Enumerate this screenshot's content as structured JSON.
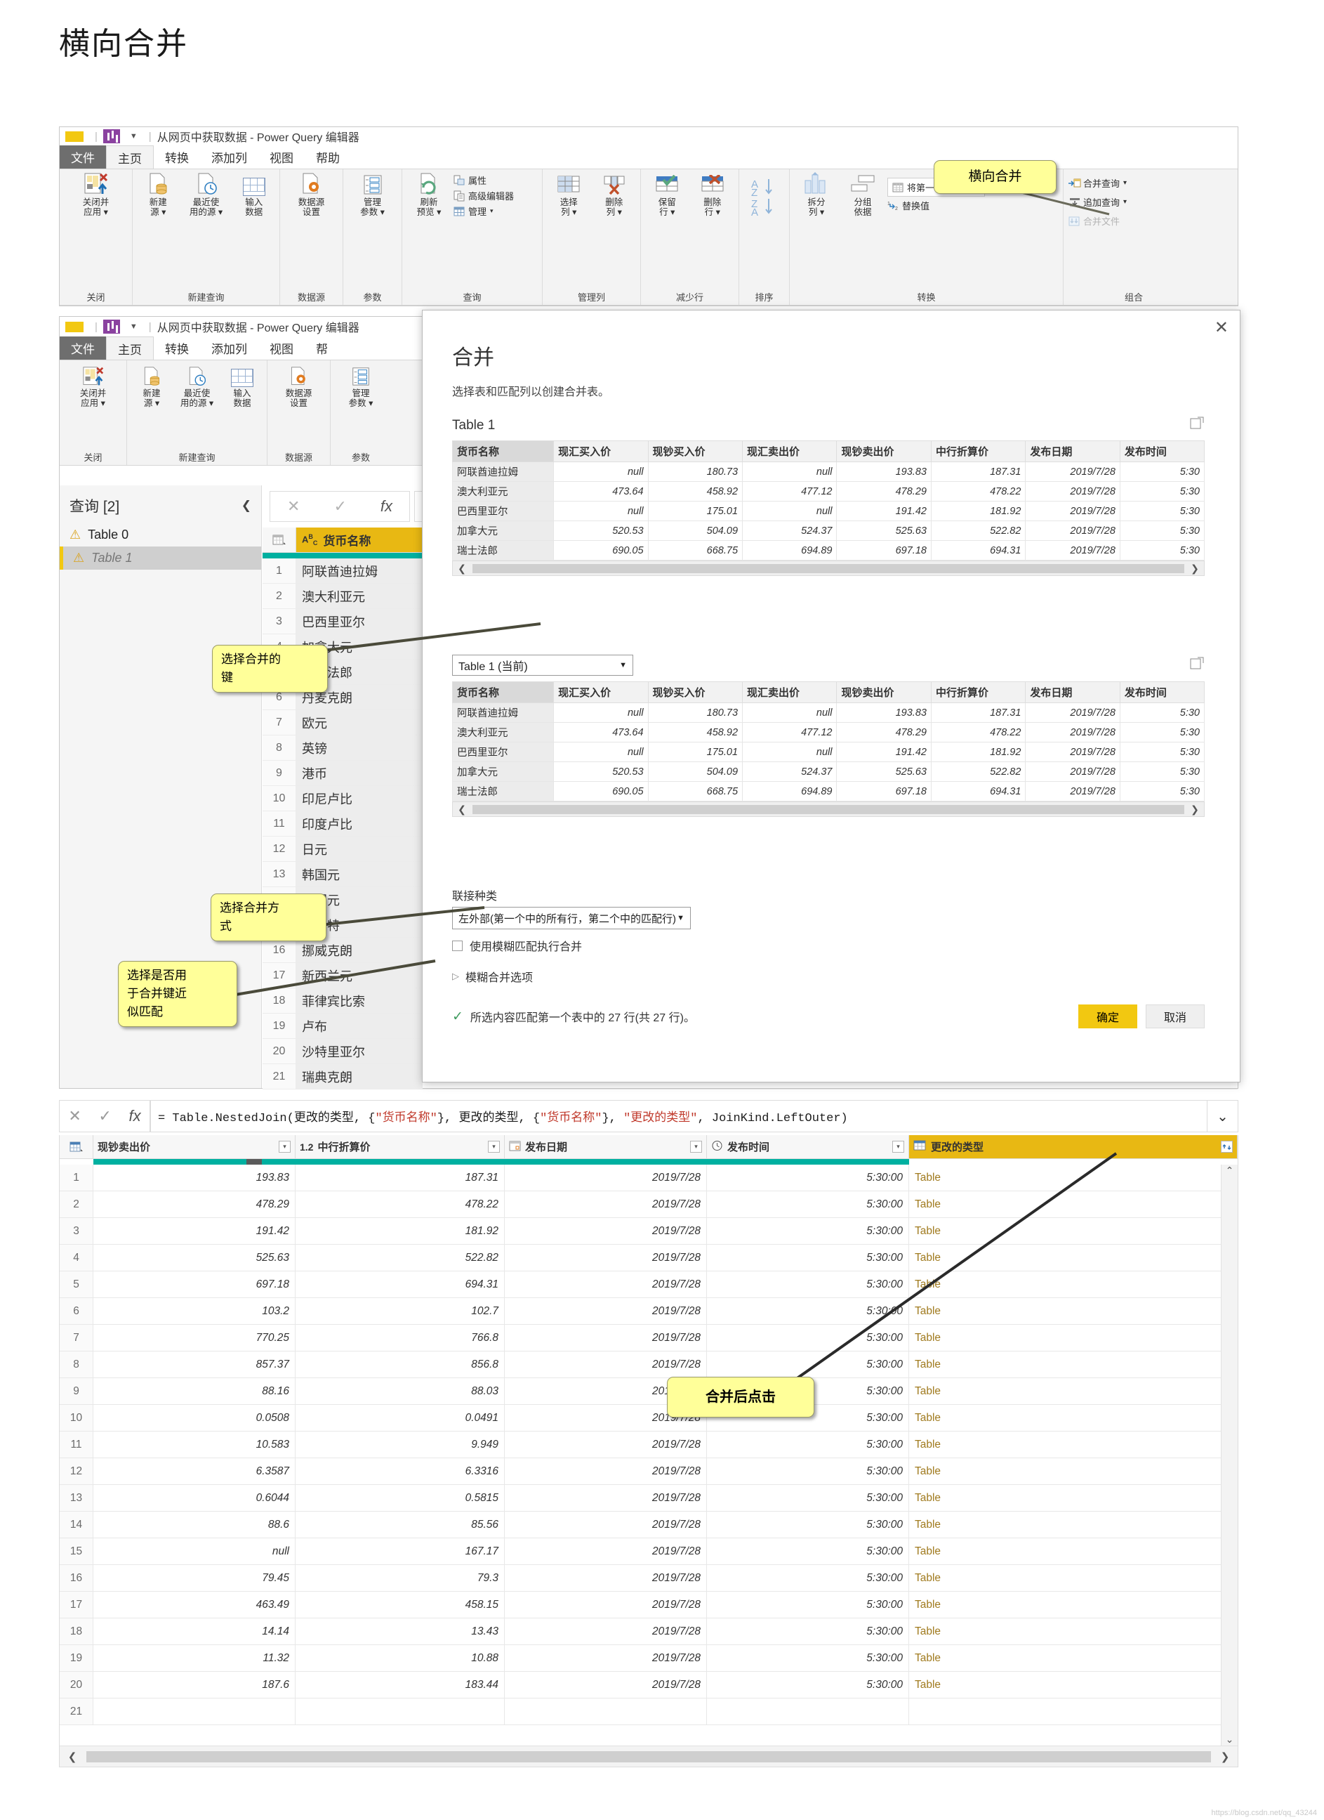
{
  "page": {
    "title": "横向合并",
    "watermark": "https://blog.csdn.net/qq_43244"
  },
  "ribbon_window": {
    "titlebar": {
      "doc_title": "从网页中获取数据 - Power Query 编辑器",
      "caret": "▼"
    },
    "tabs": [
      {
        "label": "文件",
        "kind": "file"
      },
      {
        "label": "主页",
        "kind": "active"
      },
      {
        "label": "转换",
        "kind": "normal"
      },
      {
        "label": "添加列",
        "kind": "normal"
      },
      {
        "label": "视图",
        "kind": "normal"
      },
      {
        "label": "帮助",
        "kind": "normal"
      }
    ],
    "groups": [
      {
        "label": "关闭",
        "buttons": [
          {
            "label": "关闭并\n应用",
            "caret": true,
            "icon": "close-apply-icon"
          }
        ]
      },
      {
        "label": "新建查询",
        "buttons": [
          {
            "label": "新建\n源",
            "caret": true,
            "icon": "new-source-icon"
          },
          {
            "label": "最近使\n用的源",
            "caret": true,
            "icon": "recent-source-icon"
          },
          {
            "label": "输入\n数据",
            "caret": false,
            "icon": "enter-data-icon"
          }
        ]
      },
      {
        "label": "数据源",
        "buttons": [
          {
            "label": "数据源\n设置",
            "caret": false,
            "icon": "data-source-settings-icon"
          }
        ]
      },
      {
        "label": "参数",
        "buttons": [
          {
            "label": "管理\n参数",
            "caret": true,
            "icon": "manage-parameters-icon"
          }
        ]
      },
      {
        "label": "查询",
        "buttons": [
          {
            "label": "刷新\n预览",
            "caret": true,
            "icon": "refresh-preview-icon"
          }
        ],
        "small": [
          {
            "label": "属性",
            "icon": "properties-icon"
          },
          {
            "label": "高级编辑器",
            "icon": "advanced-editor-icon"
          },
          {
            "label": "管理",
            "icon": "manage-icon",
            "caret": true
          }
        ]
      },
      {
        "label": "管理列",
        "buttons": [
          {
            "label": "选择\n列",
            "caret": true,
            "icon": "choose-columns-icon"
          },
          {
            "label": "删除\n列",
            "caret": true,
            "icon": "remove-columns-icon"
          }
        ]
      },
      {
        "label": "减少行",
        "buttons": [
          {
            "label": "保留\n行",
            "caret": true,
            "icon": "keep-rows-icon"
          },
          {
            "label": "删除\n行",
            "caret": true,
            "icon": "remove-rows-icon"
          }
        ]
      },
      {
        "label": "排序",
        "buttons": [
          {
            "label": "",
            "caret": false,
            "icon": "sort-asc-icon"
          }
        ]
      },
      {
        "label": "转换",
        "buttons": [
          {
            "label": "拆分\n列",
            "caret": true,
            "icon": "split-column-icon"
          },
          {
            "label": "分组\n依据",
            "caret": false,
            "icon": "group-by-icon"
          }
        ],
        "small": [
          {
            "label": "将第一行用作标题",
            "icon": "use-first-row-as-headers-icon",
            "caret": true
          },
          {
            "label": "替换值",
            "icon": "replace-values-icon"
          }
        ]
      },
      {
        "label": "组合",
        "small": [
          {
            "label": "合并查询",
            "icon": "merge-queries-icon",
            "caret": true
          },
          {
            "label": "追加查询",
            "icon": "append-queries-icon",
            "caret": true
          },
          {
            "label": "合并文件",
            "icon": "combine-files-icon",
            "dim": true
          }
        ]
      }
    ]
  },
  "editor_window": {
    "titlebar": {
      "doc_title": "从网页中获取数据 - Power Query 编辑器",
      "caret": "▼"
    },
    "tabs": [
      {
        "label": "文件",
        "kind": "file"
      },
      {
        "label": "主页",
        "kind": "active"
      },
      {
        "label": "转换",
        "kind": "normal"
      },
      {
        "label": "添加列",
        "kind": "normal"
      },
      {
        "label": "视图",
        "kind": "normal"
      },
      {
        "label": "帮",
        "kind": "normal"
      }
    ],
    "groups": [
      {
        "label": "关闭",
        "buttons": [
          {
            "label": "关闭并\n应用",
            "caret": true,
            "icon": "close-apply-icon"
          }
        ]
      },
      {
        "label": "新建查询",
        "buttons": [
          {
            "label": "新建\n源",
            "caret": true,
            "icon": "new-source-icon"
          },
          {
            "label": "最近使\n用的源",
            "caret": true,
            "icon": "recent-source-icon"
          },
          {
            "label": "输入\n数据",
            "caret": false,
            "icon": "enter-data-icon"
          }
        ]
      },
      {
        "label": "数据源",
        "buttons": [
          {
            "label": "数据源\n设置",
            "caret": false,
            "icon": "data-source-settings-icon"
          }
        ]
      },
      {
        "label": "参数",
        "buttons": [
          {
            "label": "管理\n参数",
            "caret": true,
            "icon": "manage-parameters-icon"
          }
        ]
      }
    ],
    "queries_pane": {
      "header": "查询 [2]",
      "collapse_icon": "chevron-left-icon",
      "items": [
        {
          "label": "Table 0",
          "warning": true,
          "selected": false
        },
        {
          "label": "Table 1",
          "warning": true,
          "selected": true
        }
      ]
    },
    "formula_bar": {
      "cancel_icon": "close-icon",
      "accept_icon": "check-icon",
      "fx_icon": "fx-icon",
      "value": ""
    },
    "preview_column_header": {
      "type_icon": "ABC",
      "label": "货币名称"
    },
    "preview_rows": [
      {
        "n": "1",
        "v": "阿联酋迪拉姆"
      },
      {
        "n": "2",
        "v": "澳大利亚元"
      },
      {
        "n": "3",
        "v": "巴西里亚尔"
      },
      {
        "n": "4",
        "v": "加拿大元"
      },
      {
        "n": "5",
        "v": "瑞士法郎"
      },
      {
        "n": "6",
        "v": "丹麦克朗"
      },
      {
        "n": "7",
        "v": "欧元"
      },
      {
        "n": "8",
        "v": "英镑"
      },
      {
        "n": "9",
        "v": "港币"
      },
      {
        "n": "10",
        "v": "印尼卢比"
      },
      {
        "n": "11",
        "v": "印度卢比"
      },
      {
        "n": "12",
        "v": "日元"
      },
      {
        "n": "13",
        "v": "韩国元"
      },
      {
        "n": "14",
        "v": "澳门元"
      },
      {
        "n": "15",
        "v": "林吉特"
      },
      {
        "n": "16",
        "v": "挪威克朗"
      },
      {
        "n": "17",
        "v": "新西兰元"
      },
      {
        "n": "18",
        "v": "菲律宾比索"
      },
      {
        "n": "19",
        "v": "卢布"
      },
      {
        "n": "20",
        "v": "沙特里亚尔"
      },
      {
        "n": "21",
        "v": "瑞典克朗"
      }
    ]
  },
  "merge_dialog": {
    "title": "合并",
    "subtitle": "选择表和匹配列以创建合并表。",
    "close_icon": "close-icon",
    "expand_icon": "expand-icon",
    "top_table_label": "Table 1",
    "bottom_table_select": "Table 1 (当前)",
    "columns": [
      "货币名称",
      "现汇买入价",
      "现钞买入价",
      "现汇卖出价",
      "现钞卖出价",
      "中行折算价",
      "发布日期",
      "发布时间"
    ],
    "rows": [
      [
        "阿联酋迪拉姆",
        "null",
        "180.73",
        "null",
        "193.83",
        "187.31",
        "2019/7/28",
        "5:30"
      ],
      [
        "澳大利亚元",
        "473.64",
        "458.92",
        "477.12",
        "478.29",
        "478.22",
        "2019/7/28",
        "5:30"
      ],
      [
        "巴西里亚尔",
        "null",
        "175.01",
        "null",
        "191.42",
        "181.92",
        "2019/7/28",
        "5:30"
      ],
      [
        "加拿大元",
        "520.53",
        "504.09",
        "524.37",
        "525.63",
        "522.82",
        "2019/7/28",
        "5:30"
      ],
      [
        "瑞士法郎",
        "690.05",
        "668.75",
        "694.89",
        "697.18",
        "694.31",
        "2019/7/28",
        "5:30"
      ]
    ],
    "join_kind_label": "联接种类",
    "join_kind_value": "左外部(第一个中的所有行，第二个中的匹配行)",
    "fuzzy_checkbox_label": "使用模糊匹配执行合并",
    "fuzzy_options_label": "模糊合并选项",
    "status_text": "所选内容匹配第一个表中的 27 行(共 27 行)。",
    "status_icon": "check-icon",
    "ok_label": "确定",
    "cancel_label": "取消",
    "scroll_left_icon": "chevron-left-icon",
    "scroll_right_icon": "chevron-right-icon"
  },
  "callouts": [
    {
      "text": "横向合并"
    },
    {
      "text": "选择合并的\n键"
    },
    {
      "text": "选择合并方\n式"
    },
    {
      "text": "选择是否用\n于合并键近\n似匹配"
    },
    {
      "text": "合并后点击"
    }
  ],
  "result_pane": {
    "formula": "= Table.NestedJoin(更改的类型, {\"货币名称\"}, 更改的类型, {\"货币名称\"}, \"更改的类型\", JoinKind.LeftOuter)",
    "formula_parts": [
      {
        "t": "= Table.NestedJoin(更改的类型, {",
        "c": "plain"
      },
      {
        "t": "\"货币名称\"",
        "c": "str"
      },
      {
        "t": "}, 更改的类型, {",
        "c": "plain"
      },
      {
        "t": "\"货币名称\"",
        "c": "str"
      },
      {
        "t": "}, ",
        "c": "plain"
      },
      {
        "t": "\"更改的类型\"",
        "c": "str"
      },
      {
        "t": ", JoinKind.LeftOuter)",
        "c": "plain"
      }
    ],
    "cancel_icon": "close-icon",
    "accept_icon": "check-icon",
    "fx_icon": "fx-icon",
    "expand_formula_icon": "chevron-down-icon",
    "columns": [
      {
        "label": "现钞卖出价",
        "type_icon": "",
        "filter": true
      },
      {
        "label": "中行折算价",
        "type_icon": "1.2",
        "filter": true
      },
      {
        "label": "发布日期",
        "type_icon": "date-icon",
        "filter": true
      },
      {
        "label": "发布时间",
        "type_icon": "clock-icon",
        "filter": true
      },
      {
        "label": "更改的类型",
        "type_icon": "table-icon",
        "filter": false,
        "highlight": true,
        "expand_icon": "expand-columns-icon"
      }
    ],
    "rows": [
      {
        "n": "1",
        "c": [
          "193.83",
          "187.31",
          "2019/7/28",
          "5:30:00",
          "Table"
        ]
      },
      {
        "n": "2",
        "c": [
          "478.29",
          "478.22",
          "2019/7/28",
          "5:30:00",
          "Table"
        ]
      },
      {
        "n": "3",
        "c": [
          "191.42",
          "181.92",
          "2019/7/28",
          "5:30:00",
          "Table"
        ]
      },
      {
        "n": "4",
        "c": [
          "525.63",
          "522.82",
          "2019/7/28",
          "5:30:00",
          "Table"
        ]
      },
      {
        "n": "5",
        "c": [
          "697.18",
          "694.31",
          "2019/7/28",
          "5:30:00",
          "Table"
        ]
      },
      {
        "n": "6",
        "c": [
          "103.2",
          "102.7",
          "2019/7/28",
          "5:30:00",
          "Table"
        ]
      },
      {
        "n": "7",
        "c": [
          "770.25",
          "766.8",
          "2019/7/28",
          "5:30:00",
          "Table"
        ]
      },
      {
        "n": "8",
        "c": [
          "857.37",
          "856.8",
          "2019/7/28",
          "5:30:00",
          "Table"
        ]
      },
      {
        "n": "9",
        "c": [
          "88.16",
          "88.03",
          "2019/7/28",
          "5:30:00",
          "Table"
        ]
      },
      {
        "n": "10",
        "c": [
          "0.0508",
          "0.0491",
          "2019/7/28",
          "5:30:00",
          "Table"
        ]
      },
      {
        "n": "11",
        "c": [
          "10.583",
          "9.949",
          "2019/7/28",
          "5:30:00",
          "Table"
        ]
      },
      {
        "n": "12",
        "c": [
          "6.3587",
          "6.3316",
          "2019/7/28",
          "5:30:00",
          "Table"
        ]
      },
      {
        "n": "13",
        "c": [
          "0.6044",
          "0.5815",
          "2019/7/28",
          "5:30:00",
          "Table"
        ]
      },
      {
        "n": "14",
        "c": [
          "88.6",
          "85.56",
          "2019/7/28",
          "5:30:00",
          "Table"
        ]
      },
      {
        "n": "15",
        "c": [
          "null",
          "167.17",
          "2019/7/28",
          "5:30:00",
          "Table"
        ]
      },
      {
        "n": "16",
        "c": [
          "79.45",
          "79.3",
          "2019/7/28",
          "5:30:00",
          "Table"
        ]
      },
      {
        "n": "17",
        "c": [
          "463.49",
          "458.15",
          "2019/7/28",
          "5:30:00",
          "Table"
        ]
      },
      {
        "n": "18",
        "c": [
          "14.14",
          "13.43",
          "2019/7/28",
          "5:30:00",
          "Table"
        ]
      },
      {
        "n": "19",
        "c": [
          "11.32",
          "10.88",
          "2019/7/28",
          "5:30:00",
          "Table"
        ]
      },
      {
        "n": "20",
        "c": [
          "187.6",
          "183.44",
          "2019/7/28",
          "5:30:00",
          "Table"
        ]
      },
      {
        "n": "21",
        "c": [
          "",
          "",
          "",
          "",
          ""
        ]
      }
    ]
  }
}
